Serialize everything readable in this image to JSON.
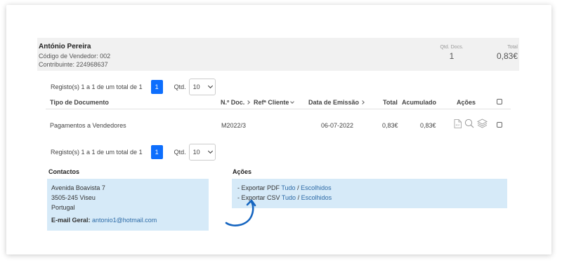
{
  "seller": {
    "name": "António Pereira",
    "code_line": "Código de Vendedor: 002",
    "tax_line": "Contribuinte: 224968637"
  },
  "summary": {
    "docs_label": "Qtd. Docs.",
    "docs_value": "1",
    "total_label": "Total",
    "total_value": "0,83€"
  },
  "pager_top": {
    "range": "Registo(s) 1 a 1 de um total de 1",
    "page": "1",
    "qty_label": "Qtd.",
    "qty_value": "10"
  },
  "pager_bottom": {
    "range": "Registo(s) 1 a 1 de um total de 1",
    "page": "1",
    "qty_label": "Qtd.",
    "qty_value": "10"
  },
  "table": {
    "headers": {
      "tipo": "Tipo de Documento",
      "num": "N.º Doc.",
      "ref": "Refª Cliente",
      "data": "Data de Emissão",
      "total": "Total",
      "acum": "Acumulado",
      "acoes": "Ações"
    },
    "rows": [
      {
        "tipo": "Pagamentos a Vendedores",
        "num": "M2022/3",
        "data": "06-07-2022",
        "total": "0,83€",
        "acum": "0,83€"
      }
    ]
  },
  "contacts": {
    "title": "Contactos",
    "address1": "Avenida Boavista 7",
    "address2": "3505-245 Viseu",
    "country": "Portugal",
    "email_label": "E-mail Geral:",
    "email": "antonio1@hotmail.com"
  },
  "actions": {
    "title": "Ações",
    "pdf_prefix": "- Exportar PDF",
    "csv_prefix": "- Exportar CSV",
    "all": "Tudo",
    "sep": "/",
    "chosen": "Escolhidos"
  },
  "colors": {
    "accent": "#0d6efd",
    "info_bg": "#d6eaf8",
    "link": "#2c6aa6",
    "arrow": "#1565c0"
  },
  "icon_names": [
    "pdf-icon",
    "search-icon",
    "layers-icon",
    "chevron-down-icon",
    "arrow-curve-icon"
  ]
}
